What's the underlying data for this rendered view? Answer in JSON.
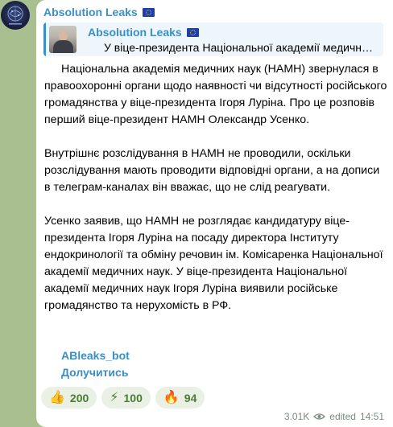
{
  "channel": {
    "name": "Absolution Leaks",
    "flag_icon": "eu-flag-icon",
    "avatar_icon": "brain-globe-avatar-icon"
  },
  "reply": {
    "name": "Absolution Leaks",
    "text": "У віце-президента Національної академії медичних наук Ігоря Луріна виявили",
    "thumbnail_icon": "person-photo-icon"
  },
  "message": {
    "paragraphs": [
      "Національна академія медичних наук (НАМН) звернулася в правоохоронні органи щодо наявності чи відсутності російського громадянства у віце-президента Ігоря Луріна. Про це розповів перший віце-президент НАМН Олександр Усенко.",
      "Внутрішнє розслідування в НАМН не проводили, оскільки розслідування мають проводити відповідні органи, а на дописи в телеграм-каналах він вважає, що не слід реагувати.",
      "Усенко заявив, що НАМН не розглядає кандидатуру віце-президента Ігоря Луріна на посаду директора Інституту ендокринології та обміну речовин ім. Комісаренка Національної академії медичних наук. У віце-президента Національної академії медичних наук Ігоря Луріна виявили російське громадянство та нерухомість в РФ."
    ],
    "links": [
      "ABleaks_bot",
      "Долучитись"
    ]
  },
  "reactions": [
    {
      "emoji": "👍",
      "icon": "thumbs-up-icon",
      "count": "200"
    },
    {
      "emoji": "⚡",
      "icon": "lightning-icon",
      "count": "100"
    },
    {
      "emoji": "🔥",
      "icon": "fire-icon",
      "count": "94"
    }
  ],
  "meta": {
    "views": "3.01K",
    "views_icon": "eye-icon",
    "edited_label": "edited",
    "time": "14:51"
  },
  "colors": {
    "background": "#a9bf8f",
    "accent": "#3a8fc8",
    "bubble": "#ffffff",
    "reaction_bg": "#e8f1e3",
    "reaction_text": "#4c7a36"
  }
}
